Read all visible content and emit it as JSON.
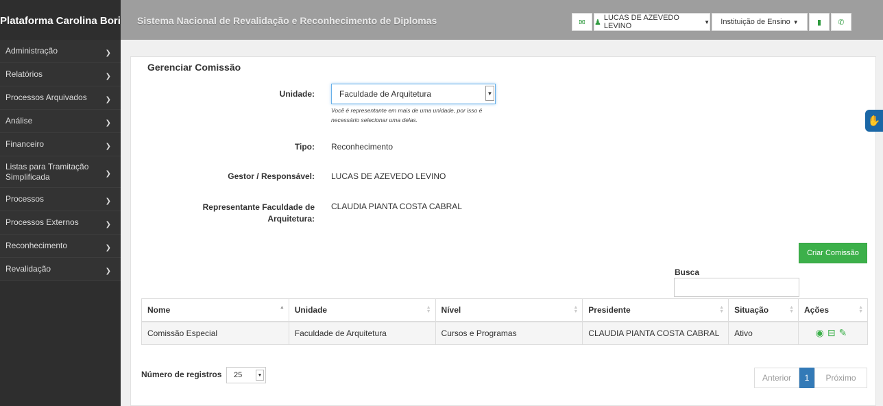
{
  "sidebar": {
    "brand": "Plataforma Carolina Bori",
    "items": [
      {
        "label": "Administração"
      },
      {
        "label": "Relatórios"
      },
      {
        "label": "Processos Arquivados"
      },
      {
        "label": "Análise"
      },
      {
        "label": "Financeiro"
      },
      {
        "label": "Listas para Tramitação Simplificada"
      },
      {
        "label": "Processos"
      },
      {
        "label": "Processos Externos"
      },
      {
        "label": "Reconhecimento"
      },
      {
        "label": "Revalidação"
      }
    ]
  },
  "topbar": {
    "title": "Sistema Nacional de Revalidação e Reconhecimento de Diplomas",
    "user": "LUCAS DE AZEVEDO LEVINO",
    "institution": "Instituição de Ensino"
  },
  "panel": {
    "title": "Gerenciar Comissão",
    "unidade_label": "Unidade:",
    "unidade_value": "Faculdade de Arquitetura",
    "unidade_help": "Você é representante em mais de uma unidade, por isso é necessário selecionar uma delas.",
    "tipo_label": "Tipo:",
    "tipo_value": "Reconhecimento",
    "gestor_label": "Gestor / Responsável:",
    "gestor_value": "LUCAS DE AZEVEDO LEVINO",
    "rep_label": "Representante Faculdade de Arquitetura:",
    "rep_value": "CLAUDIA PIANTA COSTA CABRAL",
    "criar_button": "Criar Comissão",
    "busca_label": "Busca"
  },
  "table": {
    "headers": [
      "Nome",
      "Unidade",
      "Nível",
      "Presidente",
      "Situação",
      "Ações"
    ],
    "rows": [
      [
        "Comissão Especial",
        "Faculdade de Arquitetura",
        "Cursos e Programas",
        "CLAUDIA PIANTA COSTA CABRAL",
        "Ativo"
      ]
    ]
  },
  "footer": {
    "nreg_label": "Número de registros",
    "nreg_value": "25",
    "prev": "Anterior",
    "page": "1",
    "next": "Próximo"
  },
  "colors": {
    "accent_green": "#3cb04a",
    "sidebar_bg": "#2e2e2e",
    "topbar_bg": "#9e9e9e",
    "pagination_active": "#337ab7"
  }
}
